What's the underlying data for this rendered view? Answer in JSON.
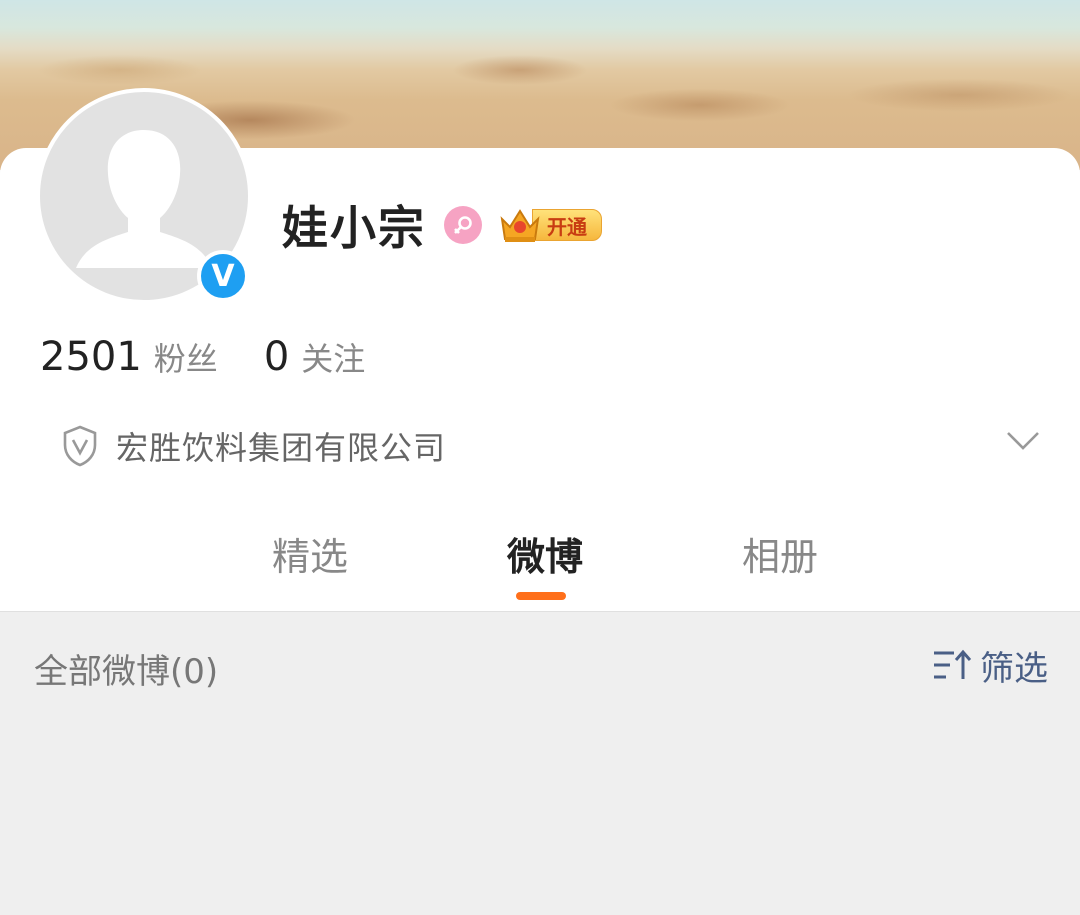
{
  "profile": {
    "username": "娃小宗",
    "vip_label": "开通",
    "followers_count": "2501",
    "followers_label": "粉丝",
    "following_count": "0",
    "following_label": "关注",
    "company": "宏胜饮料集团有限公司",
    "verified_mark": "V"
  },
  "tabs": [
    {
      "label": "精选",
      "active": false
    },
    {
      "label": "微博",
      "active": true
    },
    {
      "label": "相册",
      "active": false
    }
  ],
  "feed": {
    "title": "全部微博(0)",
    "filter_label": "筛选"
  },
  "colors": {
    "accent": "#ff6f1a",
    "verify_blue": "#1e9ff2",
    "filter_text": "#4a5f86",
    "gender_pink": "#f6a3c3"
  },
  "icons": [
    "default-avatar-icon",
    "verified-v-icon",
    "female-icon",
    "vip-crown-icon",
    "shield-v-icon",
    "chevron-down-icon",
    "sort-filter-icon"
  ]
}
